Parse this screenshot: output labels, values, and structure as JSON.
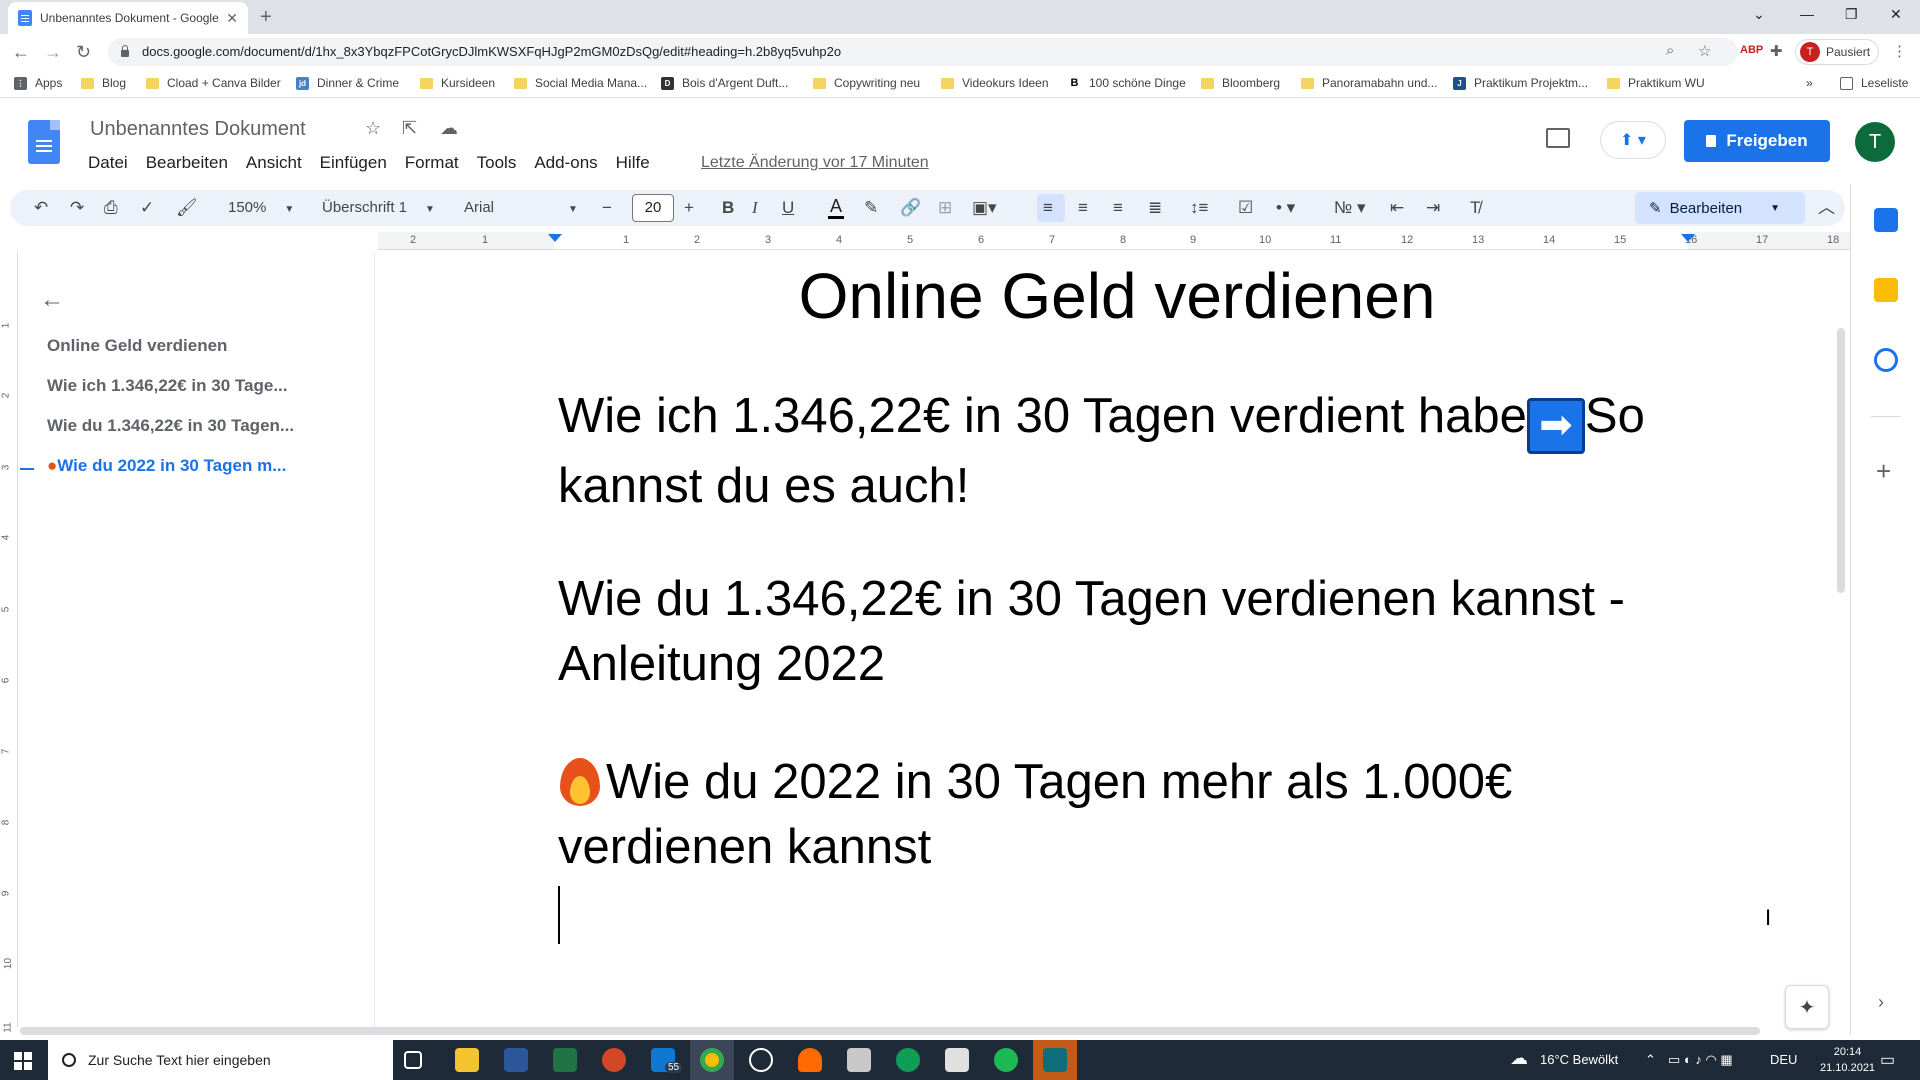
{
  "browser": {
    "tab_title": "Unbenanntes Dokument - Google",
    "url": "docs.google.com/document/d/1hx_8x3YbqzFPCotGrycDJlmKWSXFqHJgP2mGM0zDsQg/edit#heading=h.2b8yq5vuhp2o",
    "profile_initial": "T",
    "profile_label": "Pausiert",
    "reading_list": "Leseliste",
    "bookmarks": [
      "Apps",
      "Blog",
      "Cload + Canva Bilder",
      "Dinner & Crime",
      "Kursideen",
      "Social Media Mana...",
      "Bois d'Argent Duft...",
      "Copywriting neu",
      "Videokurs Ideen",
      "100 schöne Dinge",
      "Bloomberg",
      "Panoramabahn und...",
      "Praktikum Projektm...",
      "Praktikum WU"
    ]
  },
  "docs": {
    "title": "Unbenanntes Dokument",
    "menus": [
      "Datei",
      "Bearbeiten",
      "Ansicht",
      "Einfügen",
      "Format",
      "Tools",
      "Add-ons",
      "Hilfe"
    ],
    "last_edit": "Letzte Änderung vor 17 Minuten",
    "share_label": "Freigeben",
    "avatar_initial": "T",
    "accent": "#1a73e8"
  },
  "toolbar": {
    "zoom": "150%",
    "style": "Überschrift 1",
    "font": "Arial",
    "font_size": "20",
    "mode": "Bearbeiten"
  },
  "ruler": {
    "ticks": [
      "2",
      "1",
      "1",
      "2",
      "3",
      "4",
      "5",
      "6",
      "7",
      "8",
      "9",
      "10",
      "11",
      "12",
      "13",
      "14",
      "15",
      "16",
      "17",
      "18"
    ],
    "vticks": [
      "1",
      "2",
      "3",
      "4",
      "5",
      "6",
      "7",
      "8",
      "9",
      "10",
      "11"
    ]
  },
  "outline": {
    "items": [
      "Online Geld verdienen",
      "Wie ich 1.346,22€ in 30 Tage...",
      "Wie du 1.346,22€ in 30 Tagen...",
      "Wie du 2022 in 30 Tagen m..."
    ]
  },
  "document": {
    "title": "Online Geld verdienen",
    "heading1_a": "Wie ich 1.346,22€ in 30 Tagen verdient habe",
    "heading1_arrow": "➡",
    "heading1_b": "So kannst du es auch!",
    "heading2": "Wie du 1.346,22€ in 30 Tagen verdienen kannst - Anleitung 2022",
    "heading3": "Wie du 2022 in 30 Tagen mehr als 1.000€ verdienen kannst"
  },
  "taskbar": {
    "search_placeholder": "Zur Suche Text hier eingeben",
    "mail_badge": "55",
    "weather": "16°C  Bewölkt",
    "lang": "DEU",
    "time": "20:14",
    "date": "21.10.2021"
  }
}
